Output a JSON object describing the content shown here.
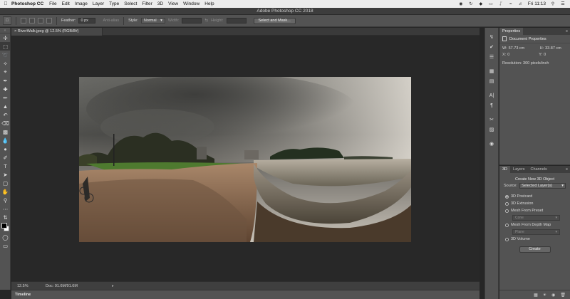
{
  "menubar": {
    "app_name": "Photoshop CC",
    "items": [
      "File",
      "Edit",
      "Image",
      "Layer",
      "Type",
      "Select",
      "Filter",
      "3D",
      "View",
      "Window",
      "Help"
    ],
    "clock": "Fri 11:13"
  },
  "window": {
    "title": "Adobe Photoshop CC 2018"
  },
  "options": {
    "feather_label": "Feather:",
    "feather_value": "0 px",
    "antialias_label": "Anti-alias",
    "style_label": "Style:",
    "style_value": "Normal",
    "width_label": "Width:",
    "height_label": "Height:",
    "select_mask_label": "Select and Mask..."
  },
  "document": {
    "tab_label": "RiverWalk.jpeg @ 12.5% (RGB/8#)",
    "zoom": "12.5%",
    "doc_size": "Doc: 91.6M/91.6M"
  },
  "timeline": {
    "label": "Timeline"
  },
  "properties": {
    "tab_label": "Properties",
    "section_title": "Document Properties",
    "w_label": "W:",
    "w_value": "57.73 cm",
    "h_label": "H:",
    "h_value": "33.87 cm",
    "x_label": "X:",
    "x_value": "0",
    "y_label": "Y:",
    "y_value": "0",
    "resolution": "Resolution: 300 pixels/inch"
  },
  "threed_panel": {
    "tabs": [
      "3D",
      "Layers",
      "Channels"
    ],
    "title": "Create New 3D Object",
    "source_label": "Source:",
    "source_value": "Selected Layer(s)",
    "options": [
      {
        "label": "3D Postcard",
        "selected": true
      },
      {
        "label": "3D Extrusion",
        "selected": false
      },
      {
        "label": "Mesh From Preset",
        "selected": false
      },
      {
        "label": "Mesh From Depth Map",
        "selected": false
      },
      {
        "label": "3D Volume",
        "selected": false
      }
    ],
    "preset_value": "Cone",
    "depth_value": "Plane",
    "create_label": "Create"
  }
}
